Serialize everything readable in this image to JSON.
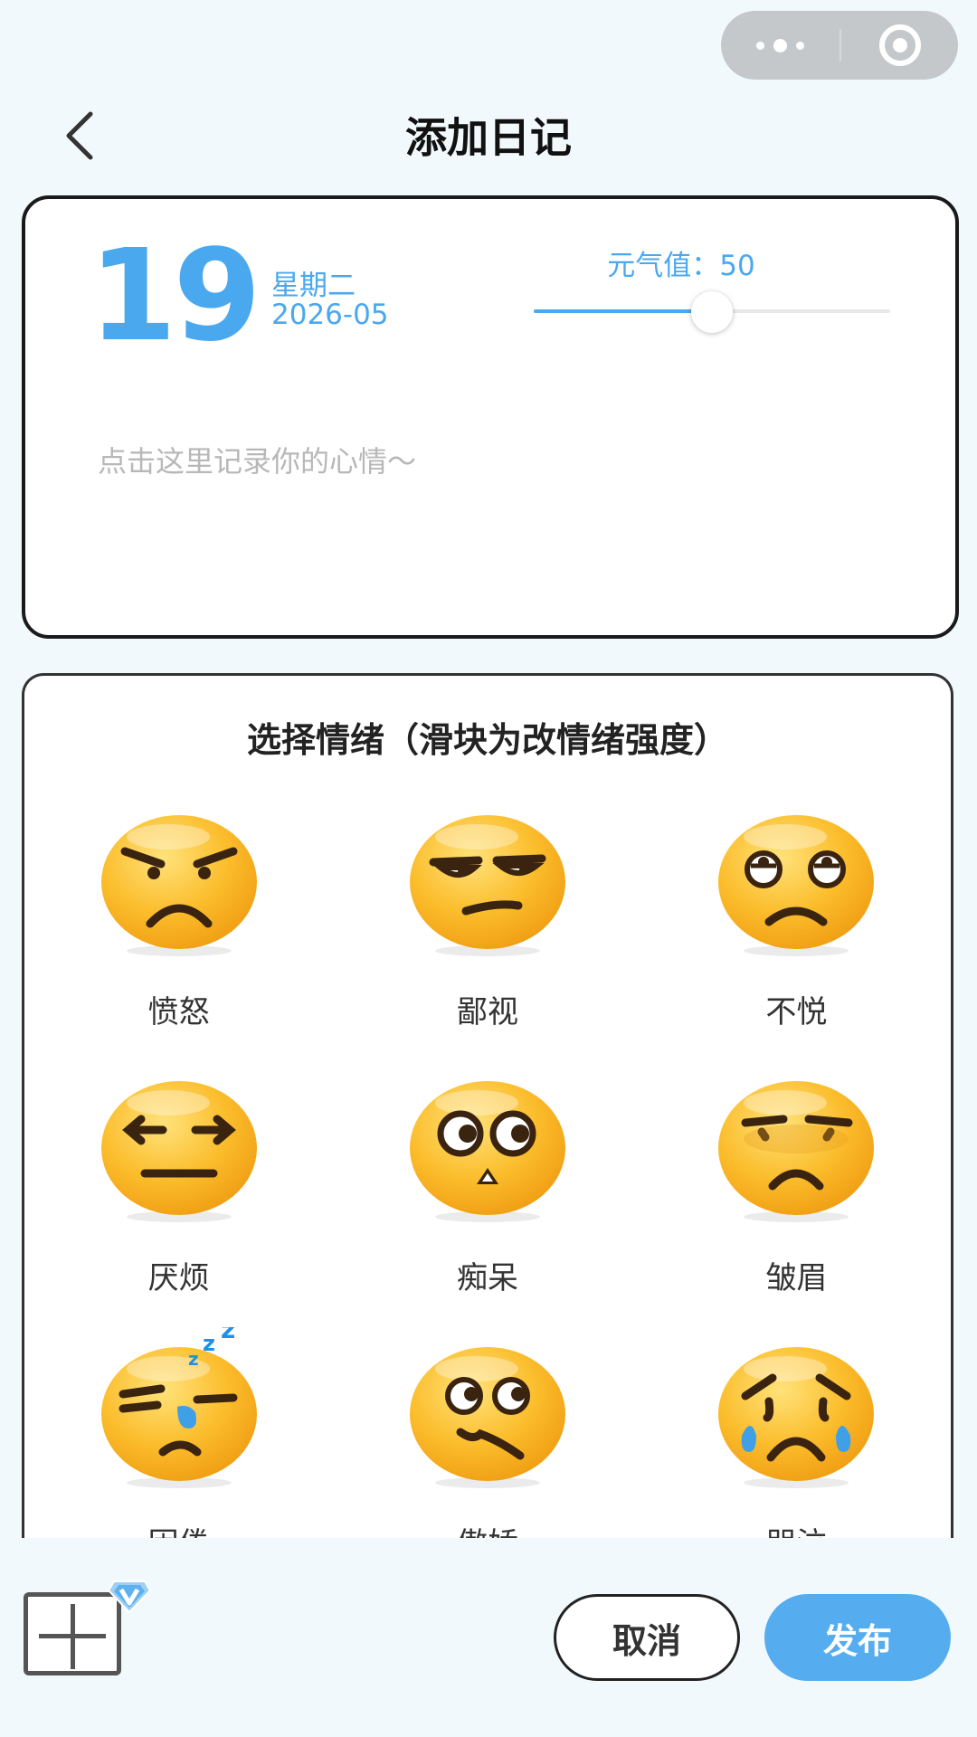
{
  "header": {
    "title": "添加日记",
    "back_icon": "chevron-left-icon",
    "menu_icon": "more-dots-icon",
    "close_icon": "target-icon"
  },
  "diary": {
    "day": "19",
    "weekday": "星期二",
    "year_month": "2026-05",
    "energy_label": "元气值：50",
    "energy_value": 50,
    "energy_max": 100,
    "mood_placeholder": "点击这里记录你的心情～",
    "mood_value": ""
  },
  "emotions": {
    "title": "选择情绪（滑块为改情绪强度）",
    "items": [
      {
        "label": "愤怒",
        "face": "angry"
      },
      {
        "label": "鄙视",
        "face": "scorn"
      },
      {
        "label": "不悦",
        "face": "displeased"
      },
      {
        "label": "厌烦",
        "face": "bored"
      },
      {
        "label": "痴呆",
        "face": "dazed"
      },
      {
        "label": "皱眉",
        "face": "frown"
      },
      {
        "label": "困倦",
        "face": "sleepy"
      },
      {
        "label": "傲娇",
        "face": "proud"
      },
      {
        "label": "哭泣",
        "face": "crying"
      }
    ]
  },
  "footer": {
    "add_icon": "plus-square-icon",
    "vip_icon": "vip-diamond-icon",
    "cancel_label": "取消",
    "publish_label": "发布"
  },
  "colors": {
    "accent": "#4aa8ef",
    "publish": "#55adef",
    "background": "#f2f9fc",
    "emoji_yellow": "#f8b21c"
  }
}
